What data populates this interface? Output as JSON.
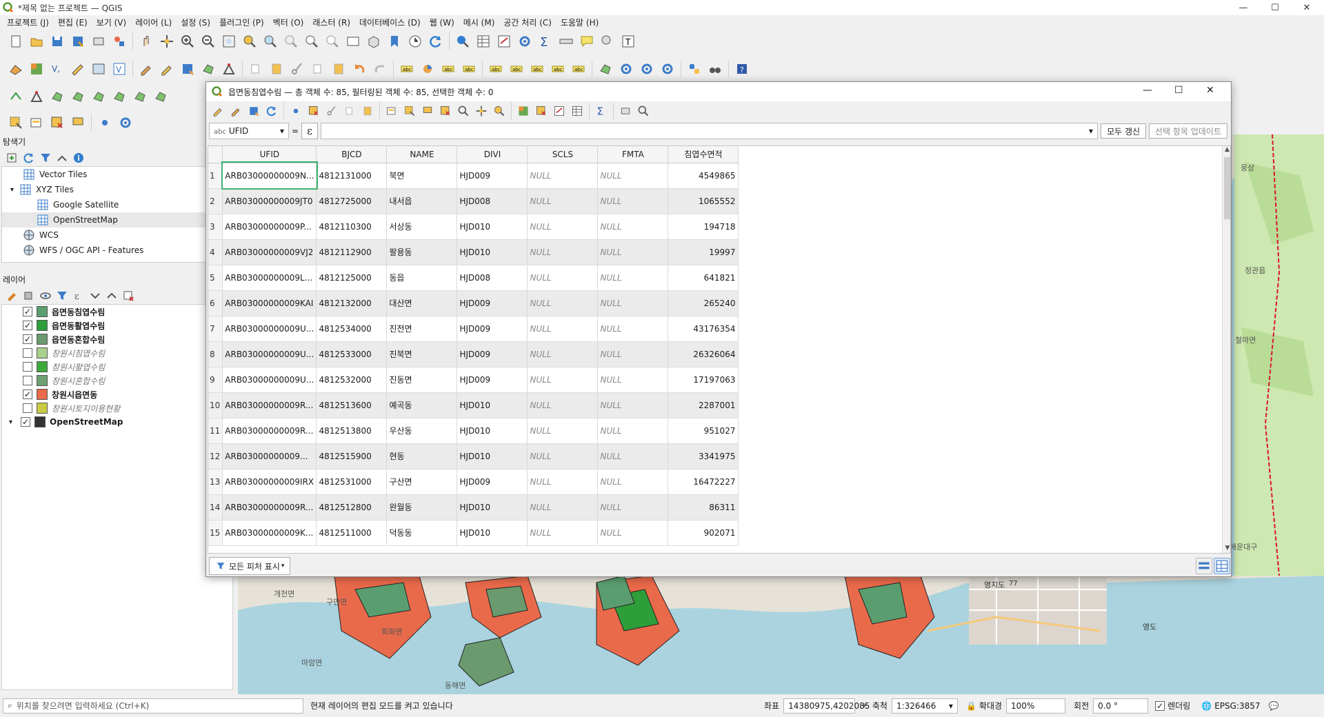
{
  "app": {
    "window_title": "*제목 없는 프로젝트 — QGIS",
    "window_controls": {
      "minimize": "—",
      "maximize": "☐",
      "close": "✕"
    }
  },
  "menubar": [
    "프로젝트 (J)",
    "편집 (E)",
    "보기 (V)",
    "레이어 (L)",
    "설정 (S)",
    "플러그인 (P)",
    "벡터 (O)",
    "래스터 (R)",
    "데이터베이스 (D)",
    "웹 (W)",
    "메시 (M)",
    "공간 처리 (C)",
    "도움말 (H)"
  ],
  "browser_panel": {
    "title": "탐색기",
    "items": [
      {
        "label": "Vector Tiles",
        "icon": "vector-tiles-icon"
      },
      {
        "label": "XYZ Tiles",
        "icon": "xyz-tiles-icon"
      },
      {
        "label": "Google Satellite",
        "icon": "tile-grid-icon"
      },
      {
        "label": "OpenStreetMap",
        "icon": "tile-grid-icon"
      },
      {
        "label": "WCS",
        "icon": "globe-icon"
      },
      {
        "label": "WFS / OGC API - Features",
        "icon": "globe-icon"
      }
    ]
  },
  "layers_panel": {
    "title": "레이어",
    "layers": [
      {
        "label": "읍면동침엽수림",
        "checked": true,
        "bold": true,
        "color": "#5a9e6f"
      },
      {
        "label": "읍면동활엽수림",
        "checked": true,
        "bold": true,
        "color": "#2e9e3a"
      },
      {
        "label": "읍면동혼합수림",
        "checked": true,
        "bold": true,
        "color": "#6a9a6e"
      },
      {
        "label": "창원시침엽수림",
        "checked": false,
        "bold": false,
        "color": "#a8d08d"
      },
      {
        "label": "창원시활엽수림",
        "checked": false,
        "bold": false,
        "color": "#3daa3d"
      },
      {
        "label": "창원시혼합수림",
        "checked": false,
        "bold": false,
        "color": "#6fa071"
      },
      {
        "label": "창원시읍면동",
        "checked": true,
        "bold": true,
        "color": "#e96a4a"
      },
      {
        "label": "창원시토지이용현황",
        "checked": false,
        "bold": false,
        "color": "#c9cc44"
      },
      {
        "label": "OpenStreetMap",
        "checked": true,
        "bold": true,
        "color": "#333333"
      }
    ]
  },
  "attribute_table": {
    "title": "읍면동침엽수림 — 총 객체 수: 85, 필터링된 객체 수: 85, 선택한 객체 수: 0",
    "field_selector": "UFID",
    "field_type": "abc",
    "equals": "=",
    "expression_symbol": "ε",
    "update_all_label": "모두 갱신",
    "update_selected_label": "선택 항목 업데이트",
    "show_all_features_label": "모든 피처 표시",
    "columns": [
      "UFID",
      "BJCD",
      "NAME",
      "DIVI",
      "SCLS",
      "FMTA",
      "침엽수면적"
    ],
    "rows": [
      [
        "1",
        "ARB03000000009N...",
        "4812131000",
        "북면",
        "HJD009",
        "NULL",
        "NULL",
        "4549865"
      ],
      [
        "2",
        "ARB03000000009JT0",
        "4812725000",
        "내서읍",
        "HJD008",
        "NULL",
        "NULL",
        "1065552"
      ],
      [
        "3",
        "ARB03000000009P...",
        "4812110300",
        "서상동",
        "HJD010",
        "NULL",
        "NULL",
        "194718"
      ],
      [
        "4",
        "ARB03000000009VJ2",
        "4812112900",
        "팔용동",
        "HJD010",
        "NULL",
        "NULL",
        "19997"
      ],
      [
        "5",
        "ARB03000000009L...",
        "4812125000",
        "동읍",
        "HJD008",
        "NULL",
        "NULL",
        "641821"
      ],
      [
        "6",
        "ARB03000000009KAI",
        "4812132000",
        "대산면",
        "HJD009",
        "NULL",
        "NULL",
        "265240"
      ],
      [
        "7",
        "ARB03000000009U...",
        "4812534000",
        "진전면",
        "HJD009",
        "NULL",
        "NULL",
        "43176354"
      ],
      [
        "8",
        "ARB03000000009U...",
        "4812533000",
        "진북면",
        "HJD009",
        "NULL",
        "NULL",
        "26326064"
      ],
      [
        "9",
        "ARB03000000009U...",
        "4812532000",
        "진동면",
        "HJD009",
        "NULL",
        "NULL",
        "17197063"
      ],
      [
        "10",
        "ARB03000000009R...",
        "4812513600",
        "예곡동",
        "HJD010",
        "NULL",
        "NULL",
        "2287001"
      ],
      [
        "11",
        "ARB03000000009R...",
        "4812513800",
        "우산동",
        "HJD010",
        "NULL",
        "NULL",
        "951027"
      ],
      [
        "12",
        "ARB03000000009...",
        "4812515900",
        "현동",
        "HJD010",
        "NULL",
        "NULL",
        "3341975"
      ],
      [
        "13",
        "ARB03000000009IRX",
        "4812531000",
        "구산면",
        "HJD009",
        "NULL",
        "NULL",
        "16472227"
      ],
      [
        "14",
        "ARB03000000009R...",
        "4812512800",
        "완월동",
        "HJD010",
        "NULL",
        "NULL",
        "86311"
      ],
      [
        "15",
        "ARB03000000009K...",
        "4812511000",
        "덕동동",
        "HJD010",
        "NULL",
        "NULL",
        "902071"
      ]
    ]
  },
  "map_labels": [
    "웅상",
    "정관읍",
    "철마면",
    "해운대구",
    "명지도",
    "77",
    "영도",
    "개천면",
    "구만면",
    "회화면",
    "마암면",
    "동해면"
  ],
  "statusbar": {
    "locator_placeholder": "위치를 찾으려면 입력하세요 (Ctrl+K)",
    "message": "현재 레이어의 편집 모드를 켜고 있습니다",
    "coord_label": "좌표",
    "coord_value": "14380975,4202085",
    "scale_label": "축척",
    "scale_value": "1:326466",
    "magnifier_label": "확대경",
    "magnifier_value": "100%",
    "rotation_label": "회전",
    "rotation_value": "0.0 °",
    "render_label": "렌더링",
    "crs": "EPSG:3857"
  }
}
